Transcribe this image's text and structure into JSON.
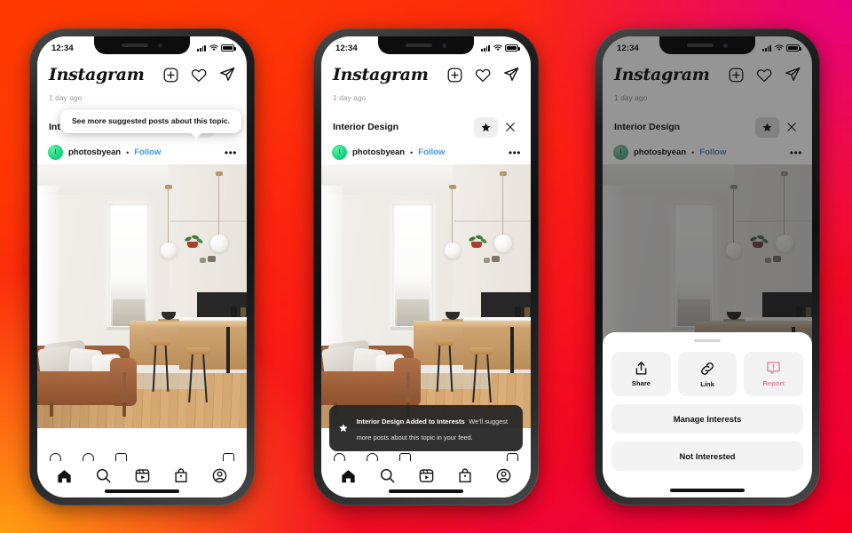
{
  "background": {
    "colors": [
      "#ff4000",
      "#fa1f12",
      "#f5001e",
      "#e6007e",
      "#ff9d12"
    ]
  },
  "status_bar": {
    "time": "12:34",
    "signal_icon": "signal-bars-icon",
    "wifi_icon": "wifi-icon",
    "battery_icon": "battery-icon"
  },
  "app": {
    "logo": "Instagram",
    "header_icons": [
      "new-post-icon",
      "heart-icon",
      "direct-message-icon"
    ]
  },
  "post": {
    "timestamp": "1 day ago",
    "topic": "Interior Design",
    "username": "photosbyean",
    "separator": "•",
    "follow_label": "Follow",
    "more_icon": "•••",
    "avatar_initial": "I",
    "star_icon": "star-icon",
    "close_icon": "close-icon",
    "follow_color": "#3a96f3"
  },
  "tabbar": {
    "items": [
      {
        "name": "home-tab-icon",
        "label": "Home"
      },
      {
        "name": "search-tab-icon",
        "label": "Search"
      },
      {
        "name": "reels-tab-icon",
        "label": "Reels"
      },
      {
        "name": "shop-tab-icon",
        "label": "Shop"
      },
      {
        "name": "profile-tab-icon",
        "label": "Profile"
      }
    ]
  },
  "phone1": {
    "tooltip": "See more suggested posts about this topic.",
    "star_state": "outline"
  },
  "phone2": {
    "star_state": "filled",
    "toast": {
      "icon": "star-filled-icon",
      "title": "Interior Design Added to Interests",
      "subtitle": "We’ll suggest more posts about this topic in your feed."
    }
  },
  "phone3": {
    "star_state": "filled",
    "sheet": {
      "quick_actions": [
        {
          "icon": "share-icon",
          "label": "Share",
          "color": "#111111"
        },
        {
          "icon": "link-icon",
          "label": "Link",
          "color": "#111111"
        },
        {
          "icon": "report-icon",
          "label": "Report",
          "color": "#e8849b"
        }
      ],
      "buttons": [
        {
          "label": "Manage Interests"
        },
        {
          "label": "Not Interested"
        }
      ]
    }
  }
}
